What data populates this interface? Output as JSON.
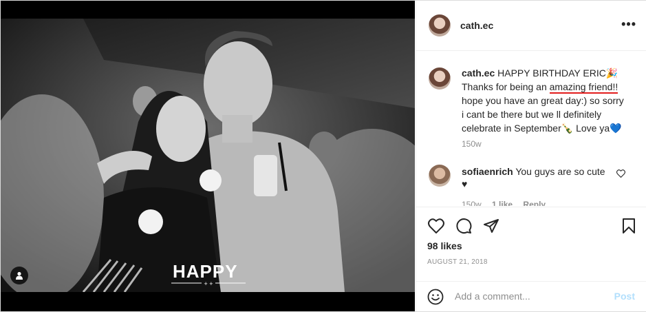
{
  "post": {
    "username": "cath.ec",
    "more_label": "•••",
    "photo_overlay_text": "HAPPY",
    "caption": {
      "username": "cath.ec",
      "part1": "HAPPY BIRTHDAY ERIC",
      "emoji1": "🎉",
      "part2": "Thanks for being an ",
      "highlight": "amazing friend!!",
      "part3": " hope you have an great day:) so sorry i cant be there but we ll definitely celebrate in September",
      "emoji2": "🍾",
      "part4": " Love ya",
      "emoji3": "💙",
      "time": "150w"
    },
    "comments": [
      {
        "username": "sofiaenrich",
        "text": " You guys are so cute",
        "emoji": "♥",
        "time": "150w",
        "likes": "1 like",
        "reply": "Reply"
      }
    ],
    "likes": "98 likes",
    "date": "AUGUST 21, 2018",
    "add_comment": {
      "placeholder": "Add a comment...",
      "post_label": "Post"
    },
    "icons": [
      "heart-icon",
      "comment-icon",
      "share-icon",
      "bookmark-icon",
      "emoji-icon",
      "user-tag-icon"
    ]
  }
}
